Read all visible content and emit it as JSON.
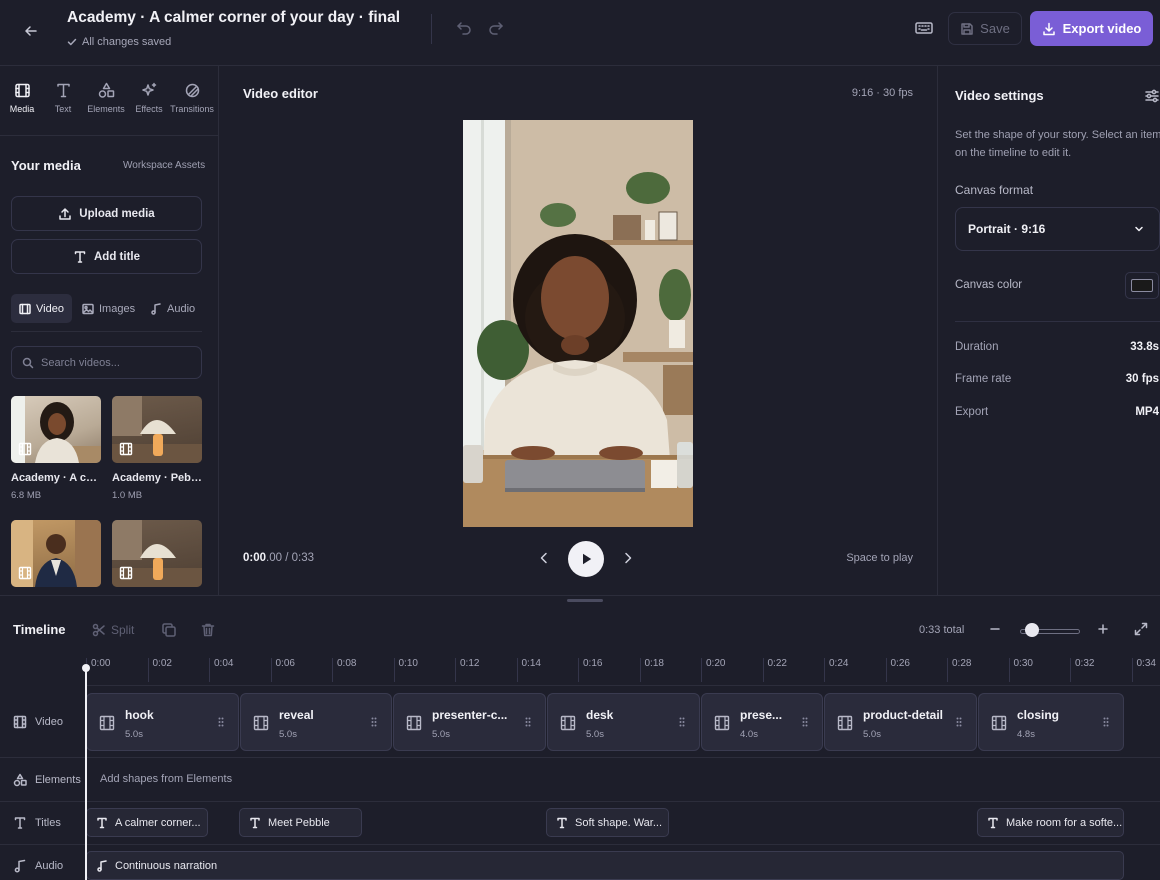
{
  "header": {
    "title": "Academy · A calmer corner of your day · final",
    "save_status": "All changes saved",
    "save_label": "Save",
    "export_label": "Export video"
  },
  "left_panel": {
    "tools": [
      {
        "label": "Media",
        "icon": "film-icon"
      },
      {
        "label": "Text",
        "icon": "text-icon"
      },
      {
        "label": "Elements",
        "icon": "shapes-icon"
      },
      {
        "label": "Effects",
        "icon": "sparkle-icon"
      },
      {
        "label": "Transitions",
        "icon": "transition-icon"
      }
    ],
    "section_title": "Your media",
    "workspace_link": "Workspace Assets",
    "upload_label": "Upload media",
    "add_title_label": "Add title",
    "media_tabs": [
      {
        "label": "Video",
        "active": true
      },
      {
        "label": "Images",
        "active": false
      },
      {
        "label": "Audio",
        "active": false
      }
    ],
    "search_placeholder": "Search videos...",
    "media_items": [
      {
        "name": "Academy · A calmer corner",
        "size": "6.8 MB"
      },
      {
        "name": "Academy · Pebble",
        "size": "1.0 MB"
      },
      {
        "name": "",
        "size": ""
      },
      {
        "name": "",
        "size": ""
      }
    ]
  },
  "stage": {
    "title": "Video editor",
    "meta": "9:16 · 30 fps",
    "timecode_current": "0:00",
    "timecode_frac": ".00",
    "timecode_total": " / 0:33",
    "space_hint": "Space to play"
  },
  "settings": {
    "title": "Video settings",
    "description": "Set the shape of your story. Select an item on the timeline to edit it.",
    "format_label": "Canvas format",
    "format_value": "Portrait · 9:16",
    "color_label": "Canvas color",
    "color_value": "#1a1a1a",
    "stats": [
      {
        "key": "Duration",
        "value": "33.8s"
      },
      {
        "key": "Frame rate",
        "value": "30 fps"
      },
      {
        "key": "Export",
        "value": "MP4"
      }
    ]
  },
  "timeline": {
    "title": "Timeline",
    "split_label": "Split",
    "total_label": "0:33 total",
    "zoom_level": 0.15,
    "ruler": [
      "0:00",
      "0:02",
      "0:04",
      "0:06",
      "0:08",
      "0:10",
      "0:12",
      "0:14",
      "0:16",
      "0:18",
      "0:20",
      "0:22",
      "0:24",
      "0:26",
      "0:28",
      "0:30",
      "0:32",
      "0:34"
    ],
    "tracks": [
      {
        "label": "Video",
        "icon": "film-icon"
      },
      {
        "label": "Elements",
        "icon": "shapes-icon"
      },
      {
        "label": "Titles",
        "icon": "text-icon"
      },
      {
        "label": "Audio",
        "icon": "music-icon"
      }
    ],
    "video_clips": [
      {
        "name": "hook",
        "duration": "5.0s"
      },
      {
        "name": "reveal",
        "duration": "5.0s"
      },
      {
        "name": "presenter-c...",
        "duration": "5.0s"
      },
      {
        "name": "desk",
        "duration": "5.0s"
      },
      {
        "name": "prese...",
        "duration": "4.0s"
      },
      {
        "name": "product-detail",
        "duration": "5.0s"
      },
      {
        "name": "closing",
        "duration": "4.8s"
      }
    ],
    "elements_hint": "Add shapes from Elements",
    "title_clips": [
      {
        "text": "A calmer corner..."
      },
      {
        "text": "Meet Pebble"
      },
      {
        "text": "Soft shape. War..."
      },
      {
        "text": "Make room for a softe..."
      }
    ],
    "audio_clip": "Continuous narration"
  },
  "colors": {
    "accent": "#7a5ed6",
    "background": "#1c1d29",
    "panel": "#1d1e2a",
    "clip": "#2a2b3b"
  }
}
